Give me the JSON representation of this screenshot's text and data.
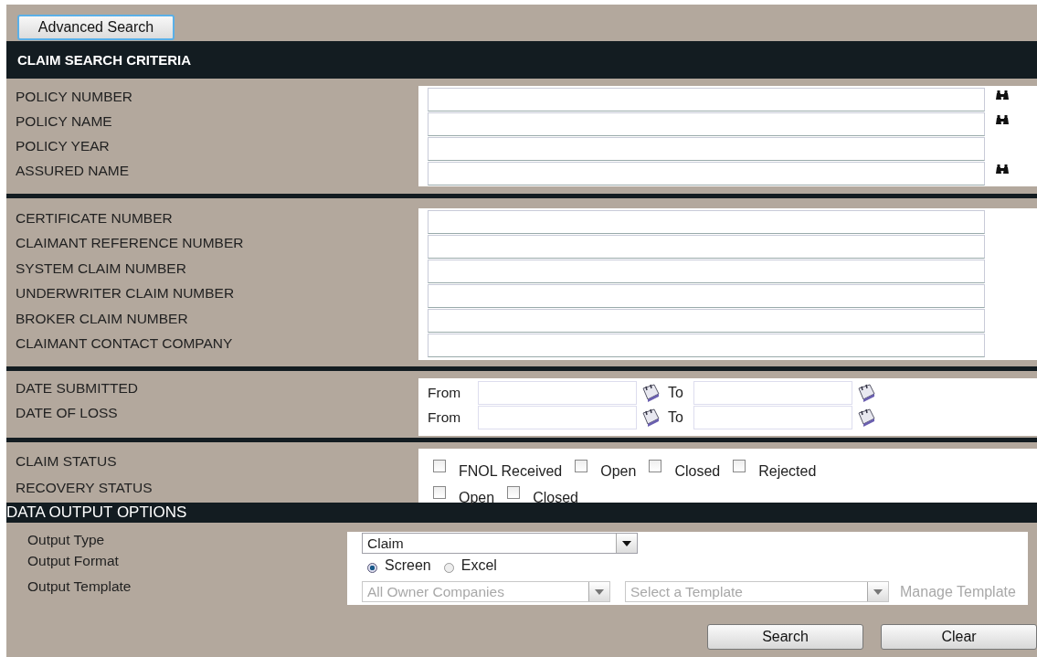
{
  "advanced_search_button": "Advanced Search",
  "criteria_header": "CLAIM SEARCH CRITERIA",
  "sections": [
    {
      "kind": "text_fields",
      "fields": [
        {
          "label": "POLICY NUMBER",
          "kind": "lookup"
        },
        {
          "label": "POLICY NAME",
          "kind": "lookup"
        },
        {
          "label": "POLICY YEAR",
          "kind": "plain"
        },
        {
          "label": "ASSURED NAME",
          "kind": "lookup"
        }
      ]
    },
    {
      "kind": "text_fields",
      "fields": [
        {
          "label": "CERTIFICATE NUMBER",
          "kind": "plain"
        },
        {
          "label": "CLAIMANT REFERENCE NUMBER",
          "kind": "plain"
        },
        {
          "label": "SYSTEM CLAIM NUMBER",
          "kind": "plain"
        },
        {
          "label": "UNDERWRITER CLAIM NUMBER",
          "kind": "plain"
        },
        {
          "label": "BROKER CLAIM NUMBER",
          "kind": "plain"
        },
        {
          "label": "CLAIMANT CONTACT COMPANY",
          "kind": "plain"
        }
      ]
    },
    {
      "kind": "date_ranges",
      "rows": [
        {
          "label": "DATE SUBMITTED",
          "from": "From",
          "to": "To"
        },
        {
          "label": "DATE OF LOSS",
          "from": "From",
          "to": "To"
        }
      ]
    },
    {
      "kind": "checkbox_groups",
      "groups": [
        {
          "label": "CLAIM STATUS",
          "options": [
            {
              "label": "FNOL Received",
              "checked": false
            },
            {
              "label": "Open",
              "checked": false
            },
            {
              "label": "Closed",
              "checked": false
            },
            {
              "label": "Rejected",
              "checked": false
            }
          ]
        },
        {
          "label": "RECOVERY STATUS",
          "options": [
            {
              "label": "Open",
              "checked": false
            },
            {
              "label": "Closed",
              "checked": false
            }
          ]
        }
      ]
    }
  ],
  "output_header": "DATA OUTPUT OPTIONS",
  "output": {
    "type_label": "Output Type",
    "type_value": "Claim",
    "format_label": "Output Format",
    "formats": [
      {
        "label": "Screen",
        "selected": true
      },
      {
        "label": "Excel",
        "selected": false
      }
    ],
    "template_label": "Output Template",
    "owner_select": {
      "value": "All Owner Companies",
      "disabled": true
    },
    "template_select": {
      "value": "Select a Template",
      "disabled": true
    },
    "manage_link": {
      "label": "Manage Template",
      "disabled": true
    }
  },
  "buttons": [
    "Search",
    "Clear"
  ]
}
